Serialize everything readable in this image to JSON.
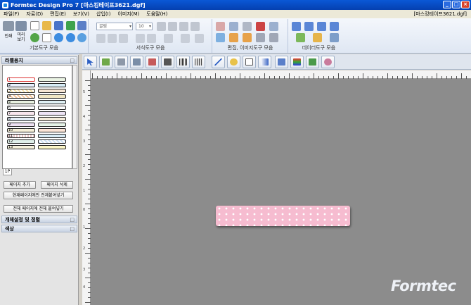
{
  "window": {
    "title": "Formtec Design Pro 7 [마스킹테이프3621.dgf]",
    "min": "_",
    "max": "□",
    "close": "×",
    "doc_name": "[마스킹테이프3621.dgf]"
  },
  "menu": [
    "파일(F)",
    "자료(D)",
    "편집(E)",
    "보기(V)",
    "삽입(I)",
    "이미지(M)",
    "도움말(H)"
  ],
  "ribbon": {
    "basic": {
      "label": "기본도구 모음",
      "print": "인쇄",
      "preview": "미리\n보기"
    },
    "format": {
      "label": "서식도구 모음",
      "font": "굴림",
      "size": "10"
    },
    "edit": {
      "label": "편집, 이미지도구 모음"
    },
    "data": {
      "label": "데이터도구 모음"
    }
  },
  "left": {
    "label_paper": "라벨용지",
    "page_tab": "1P",
    "rows": [
      "1",
      "2",
      "3",
      "4",
      "5",
      "6",
      "7",
      "8",
      "9",
      "10",
      "11",
      "12",
      "13"
    ],
    "buttons": {
      "add_page": "페이지 추가",
      "delete_page": "페이지 삭제",
      "paste_current": "현재페이지에만 전체붙여넣기",
      "paste_all": "전체 페이지에 전체 붙여넣기"
    },
    "object_settings": "개체설정 및 정렬",
    "color": "색상"
  },
  "ruler": {
    "left_numbers": [
      "5",
      "4",
      "3",
      "2",
      "1",
      "0",
      "1",
      "2",
      "3",
      "4",
      "5"
    ]
  },
  "brand": {
    "logo": "Formtec"
  },
  "colors": {
    "title_bar": "#0a58d6",
    "label_pink": "#f6bcd0",
    "canvas": "#8c8c8c"
  }
}
